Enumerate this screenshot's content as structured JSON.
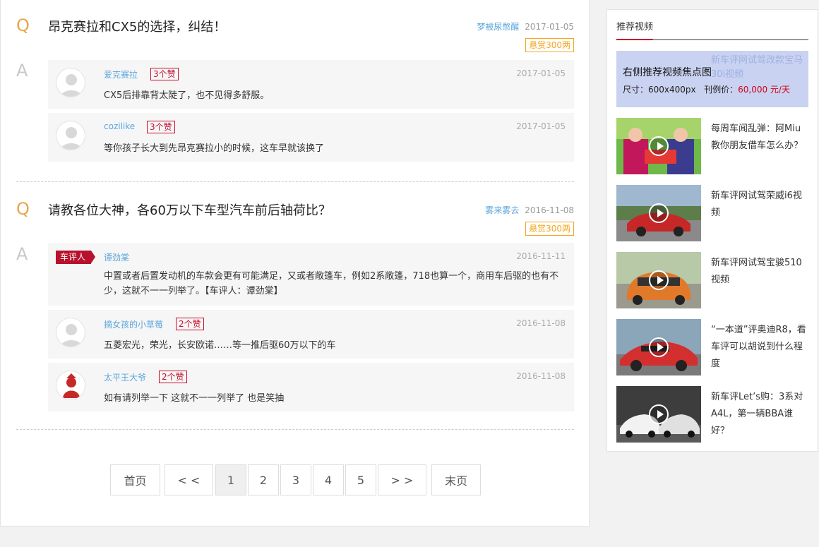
{
  "questions": [
    {
      "q_letter": "Q",
      "title": "昂克赛拉和CX5的选择，纠结！",
      "user": "梦被尿憋醒",
      "date": "2017-01-05",
      "reward": "悬赏300两",
      "a_letter": "A",
      "answers": [
        {
          "user": "爱克赛拉",
          "likes": "3个赞",
          "date": "2017-01-05",
          "text": "CX5后排靠背太陡了，也不见得多舒服。"
        },
        {
          "user": "cozilike",
          "likes": "3个赞",
          "date": "2017-01-05",
          "text": "等你孩子长大到先昂克赛拉小的时候，这车早就该换了"
        }
      ]
    },
    {
      "q_letter": "Q",
      "title": "请教各位大神，各60万以下车型汽车前后轴荷比？",
      "user": "雾来雾去",
      "date": "2016-11-08",
      "reward": "悬赏300两",
      "a_letter": "A",
      "answers": [
        {
          "badge": "车评人",
          "user": "谭劲棠",
          "likes": "",
          "date": "2016-11-11",
          "text": "中置或者后置发动机的车款会更有可能满足，又或者敞篷车，例如2系敞篷，718也算一个，商用车后驱的也有不少，这就不一一列举了。【车评人：谭劲棠】"
        },
        {
          "user": "摘女孩的小草莓",
          "likes": "2个赞",
          "date": "2016-11-08",
          "text": "五菱宏光，荣光，长安欧诺……等一推后驱60万以下的车"
        },
        {
          "user": "太平王大爷",
          "likes": "2个赞",
          "date": "2016-11-08",
          "text": "如有请列举一下 这就不一一列举了 也是笑抽"
        }
      ]
    }
  ],
  "pagination": {
    "first": "首页",
    "prev": "< <",
    "pages": [
      "1",
      "2",
      "3",
      "4",
      "5"
    ],
    "current": "1",
    "next": "> >",
    "last": "末页"
  },
  "sidebar": {
    "title": "推荐视频",
    "ad": {
      "faint_text": "新车评网试驾改款宝马30i视频",
      "title": "右侧推荐视频焦点图",
      "size_label": "尺寸：",
      "size_value": "600x400px",
      "price_label": "刊例价：",
      "price_value": "60,000 元/天"
    },
    "videos": [
      {
        "title": "每周车闻乱弹：阿Miu教你朋友借车怎么办？"
      },
      {
        "title": "新车评网试驾荣威i6视频"
      },
      {
        "title": "新车评网试驾宝骏510视频"
      },
      {
        "title": "“一本道”评奥迪R8，看车评可以胡说到什么程度"
      },
      {
        "title": "新车评Let’s购：3系对A4L，第一辆BBA谁好？"
      }
    ]
  },
  "colors": {
    "accent": "#c4102f",
    "link": "#5aa5dc",
    "reward": "#f5a623",
    "q_letter": "#e8a64a"
  }
}
